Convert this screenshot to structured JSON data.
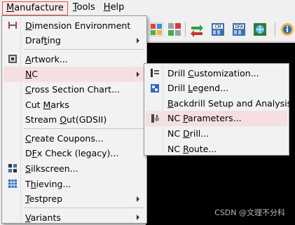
{
  "menubar": [
    {
      "label": "Manufacture",
      "mnemonic_index": 0,
      "open": true
    },
    {
      "label": "Tools",
      "mnemonic_index": 0,
      "open": false
    },
    {
      "label": "Help",
      "mnemonic_index": 0,
      "open": false
    }
  ],
  "main_menu": [
    {
      "label": "Dimension Environment",
      "mnemonic_index": 0,
      "icon": "dimension-icon",
      "submenu": false
    },
    {
      "label": "Drafting",
      "mnemonic_index": 4,
      "icon": "",
      "submenu": true
    },
    {
      "separator": true
    },
    {
      "label": "Artwork...",
      "mnemonic_index": 0,
      "icon": "artwork-icon",
      "submenu": false
    },
    {
      "label": "NC",
      "mnemonic_index": 0,
      "icon": "",
      "submenu": true,
      "highlighted": true
    },
    {
      "label": "Cross Section Chart...",
      "mnemonic_index": 0,
      "icon": "",
      "submenu": false
    },
    {
      "label": "Cut Marks",
      "mnemonic_index": 4,
      "icon": "",
      "submenu": false
    },
    {
      "label": "Stream Out(GDSII)",
      "mnemonic_index": 7,
      "icon": "",
      "submenu": false
    },
    {
      "separator": true
    },
    {
      "label": "Create Coupons...",
      "mnemonic_index": 0,
      "icon": "",
      "submenu": false
    },
    {
      "label": "DFx Check (legacy)...",
      "mnemonic_index": 1,
      "icon": "",
      "submenu": false
    },
    {
      "label": "Silkscreen...",
      "mnemonic_index": 0,
      "icon": "silkscreen-icon",
      "submenu": false
    },
    {
      "label": "Thieving...",
      "mnemonic_index": 1,
      "icon": "thieving-icon",
      "submenu": false
    },
    {
      "label": "Testprep",
      "mnemonic_index": 0,
      "icon": "",
      "submenu": true
    },
    {
      "separator": true
    },
    {
      "label": "Variants",
      "mnemonic_index": 0,
      "icon": "",
      "submenu": true
    }
  ],
  "nc_submenu": [
    {
      "label": "Drill Customization...",
      "mnemonic_index": 6,
      "icon": "drill-customization-icon",
      "highlighted": false
    },
    {
      "label": "Drill Legend...",
      "mnemonic_index": 6,
      "icon": "drill-legend-icon",
      "highlighted": false
    },
    {
      "label": "Backdrill Setup and Analysis...",
      "mnemonic_index": 0,
      "icon": "",
      "highlighted": false
    },
    {
      "label": "NC Parameters...",
      "mnemonic_index": 3,
      "icon": "nc-parameters-icon",
      "highlighted": true
    },
    {
      "label": "NC Drill...",
      "mnemonic_index": 3,
      "icon": "",
      "highlighted": false
    },
    {
      "label": "NC Route...",
      "mnemonic_index": 3,
      "icon": "",
      "highlighted": false
    }
  ],
  "toolbar_icons": [
    "layout-grid-icon",
    "component-grid-icon",
    "swap-icon",
    "cm-icon",
    "dfa-icon",
    "globe-grid-icon",
    "info-icon"
  ],
  "watermark": "CSDN @文理不分科",
  "colors": {
    "highlight": "#f6dfe1",
    "open_menu_border": "#d9534f",
    "canvas": "#000000"
  }
}
